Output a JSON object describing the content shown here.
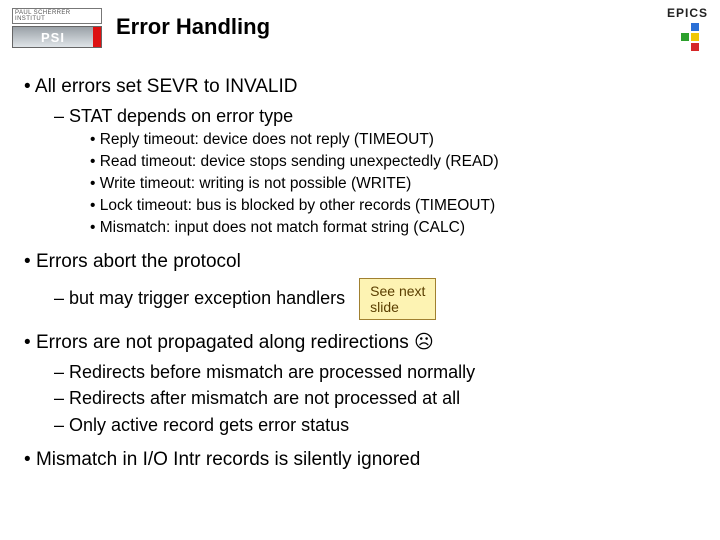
{
  "header": {
    "logo_subtitle": "PAUL SCHERRER INSTITUT",
    "logo_text": "PSI",
    "title": "Error Handling",
    "epics_label": "EPICS"
  },
  "bullets": {
    "b1": "All errors set SEVR to INVALID",
    "b1_1": "STAT depends on error type",
    "b1_1_a": "Reply timeout: device does not reply (TIMEOUT)",
    "b1_1_b": "Read timeout: device stops sending unexpectedly (READ)",
    "b1_1_c": "Write timeout: writing is not possible (WRITE)",
    "b1_1_d": "Lock timeout: bus is blocked by other records (TIMEOUT)",
    "b1_1_e": "Mismatch: input does not match format string (CALC)",
    "b2": "Errors abort the protocol",
    "b2_1": "but may trigger exception handlers",
    "note_l1": "See next",
    "note_l2": "slide",
    "b3": "Errors are not propagated along redirections ☹",
    "b3_1": "Redirects before mismatch are processed normally",
    "b3_2": "Redirects after mismatch are not processed at all",
    "b3_3": "Only active record gets error status",
    "b4": "Mismatch in I/O Intr records is silently ignored"
  }
}
